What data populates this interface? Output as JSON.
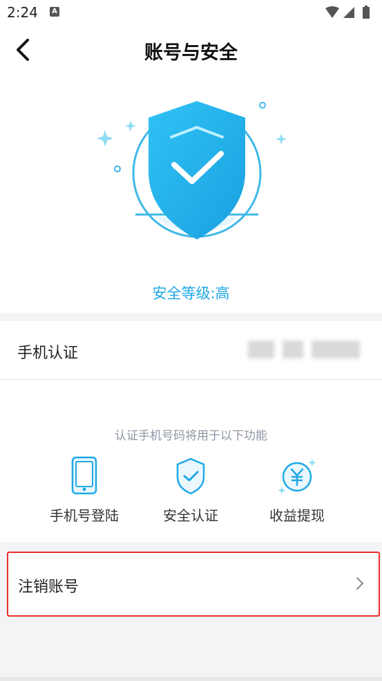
{
  "status_bar": {
    "time": "2:24",
    "notification_glyph": "A"
  },
  "header": {
    "title": "账号与安全",
    "back_icon": "chevron-left-icon"
  },
  "hero": {
    "security_level": "安全等级:高",
    "accent_color": "#1fa8e6"
  },
  "phone_verification": {
    "label": "手机认证",
    "value_obscured": true
  },
  "features": {
    "caption": "认证手机号码将用于以下功能",
    "items": [
      {
        "label": "手机号登陆",
        "icon": "phone-icon"
      },
      {
        "label": "安全认证",
        "icon": "shield-check-icon"
      },
      {
        "label": "收益提现",
        "icon": "yuan-coin-icon"
      }
    ]
  },
  "deactivate": {
    "label": "注销账号",
    "highlight_color": "#e82d2d"
  }
}
